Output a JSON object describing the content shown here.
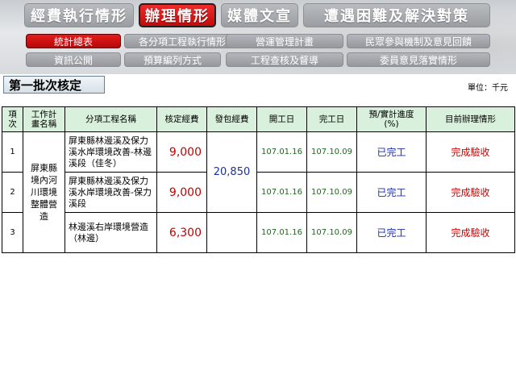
{
  "nav": {
    "tabs": [
      {
        "label": "經費執行情形",
        "active": false
      },
      {
        "label": "辦理情形",
        "active": true
      },
      {
        "label": "媒體文宣",
        "active": false
      },
      {
        "label": "遭遇困難及解決對策",
        "active": false
      }
    ],
    "subtabs_row1": [
      {
        "label": "統計總表",
        "active": true
      },
      {
        "label": "各分項工程執行情形",
        "active": false
      },
      {
        "label": "營運管理計畫",
        "active": false
      },
      {
        "label": "民眾參與機制及意見回饋",
        "active": false
      }
    ],
    "subtabs_row2": [
      {
        "label": "資訊公開",
        "active": false
      },
      {
        "label": "預算編列方式",
        "active": false
      },
      {
        "label": "工程查核及督導",
        "active": false
      },
      {
        "label": "委員意見落實情形",
        "active": false
      }
    ]
  },
  "section": {
    "title": "第一批次核定",
    "unit": "單位：千元"
  },
  "table": {
    "headers": {
      "index": "項\n次",
      "plan": "工作計\n畫名稱",
      "project": "分項工程名稱",
      "approved": "核定經費",
      "contract": "發包經費",
      "start": "開工日",
      "end": "完工日",
      "progress": "預/實計進度\n(%)",
      "status": "目前辦理情形"
    },
    "plan_name": "屏東縣\n境內河\n川環境\n整體營\n造",
    "contract_total": "20,850",
    "rows": [
      {
        "index": "1",
        "project": "屏東縣林邊溪及保力溪水岸環境改善-林邊溪段（佳冬）",
        "approved": "9,000",
        "start": "107.01.16",
        "end": "107.10.09",
        "progress": "已完工",
        "status": "完成驗收"
      },
      {
        "index": "2",
        "project": "屏東縣林邊溪及保力溪水岸環境改善-保力溪段",
        "approved": "9,000",
        "start": "107.01.16",
        "end": "107.10.09",
        "progress": "已完工",
        "status": "完成驗收"
      },
      {
        "index": "3",
        "project": "林邊溪右岸環境營造（林邊）",
        "approved": "6,300",
        "start": "107.01.16",
        "end": "107.10.09",
        "progress": "已完工",
        "status": "完成驗收"
      }
    ]
  },
  "colors": {
    "active_tab": "#d81515",
    "inactive_tab": "#a7aaae",
    "table_header": "#d9f0dc",
    "money": "#c00000",
    "date": "#1a6a1a",
    "progress": "#1c2fa8"
  }
}
